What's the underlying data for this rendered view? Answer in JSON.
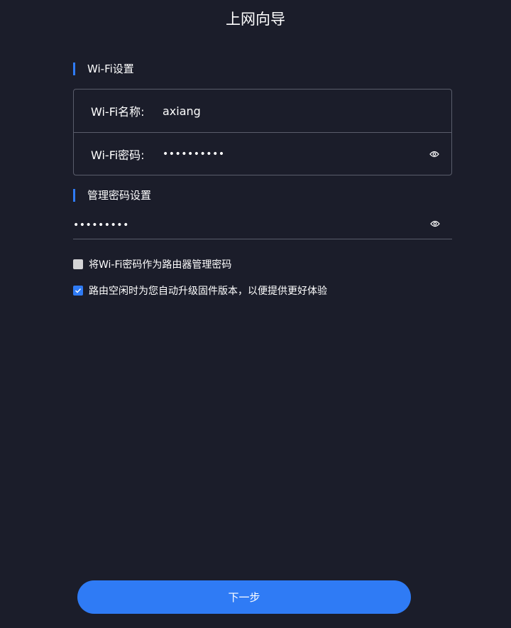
{
  "header": {
    "title": "上网向导"
  },
  "wifi_section": {
    "title": "Wi-Fi设置",
    "name_label": "Wi-Fi名称:",
    "name_value": "axiang",
    "password_label": "Wi-Fi密码:",
    "password_value": "••••••••••",
    "password_icon": "eye-icon"
  },
  "admin_section": {
    "title": "管理密码设置",
    "password_value": "•••••••••",
    "password_icon": "eye-icon"
  },
  "options": [
    {
      "label": "将Wi-Fi密码作为路由器管理密码",
      "checked": false
    },
    {
      "label": "路由空闲时为您自动升级固件版本，以便提供更好体验",
      "checked": true
    }
  ],
  "footer": {
    "next_label": "下一步"
  },
  "colors": {
    "background": "#1b1d2a",
    "accent": "#2f7bf5",
    "border": "#5a5d6b",
    "text": "#ffffff"
  }
}
